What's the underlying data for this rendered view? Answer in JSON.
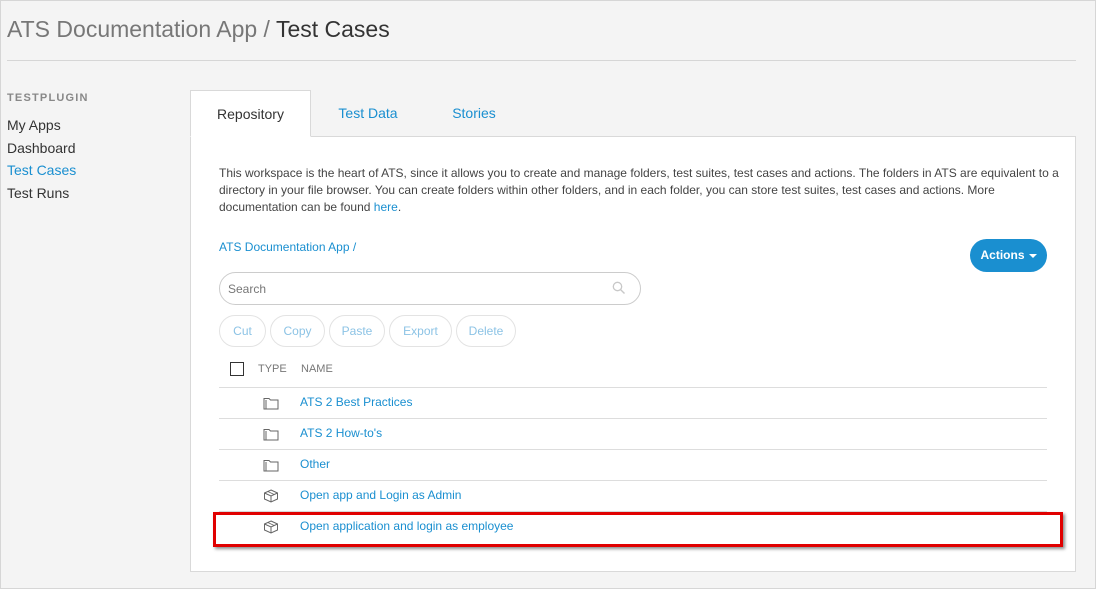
{
  "header": {
    "app_name": "ATS Documentation App",
    "separator": " / ",
    "page_title": "Test Cases"
  },
  "sidebar": {
    "section_title": "TESTPLUGIN",
    "items": [
      {
        "label": "My Apps",
        "active": false
      },
      {
        "label": "Dashboard",
        "active": false
      },
      {
        "label": "Test Cases",
        "active": true
      },
      {
        "label": "Test Runs",
        "active": false
      }
    ]
  },
  "tabs": [
    {
      "label": "Repository",
      "active": true
    },
    {
      "label": "Test Data",
      "active": false
    },
    {
      "label": "Stories",
      "active": false
    }
  ],
  "description": {
    "text": "This workspace is the heart of ATS, since it allows you to create and manage folders, test suites, test cases and actions. The folders in ATS are equivalent to a directory in your file browser. You can create folders within other folders, and in each folder, you can store test suites, test cases and actions. More documentation can be found ",
    "link_label": "here",
    "end": "."
  },
  "breadcrumb": "ATS Documentation App /",
  "actions_button": "Actions",
  "search": {
    "placeholder": "Search",
    "value": ""
  },
  "toolbar": {
    "cut": "Cut",
    "copy": "Copy",
    "paste": "Paste",
    "export": "Export",
    "delete": "Delete"
  },
  "table": {
    "columns": {
      "type": "TYPE",
      "name": "NAME"
    },
    "rows": [
      {
        "type_icon": "folder-icon",
        "name": "ATS 2 Best Practices"
      },
      {
        "type_icon": "folder-icon",
        "name": "ATS 2 How-to's"
      },
      {
        "type_icon": "folder-icon",
        "name": "Other"
      },
      {
        "type_icon": "cube-icon",
        "name": "Open app and Login as Admin"
      },
      {
        "type_icon": "cube-icon",
        "name": "Open application and login as employee"
      }
    ]
  },
  "colors": {
    "accent": "#1a8fd0",
    "highlight": "#e00000"
  }
}
